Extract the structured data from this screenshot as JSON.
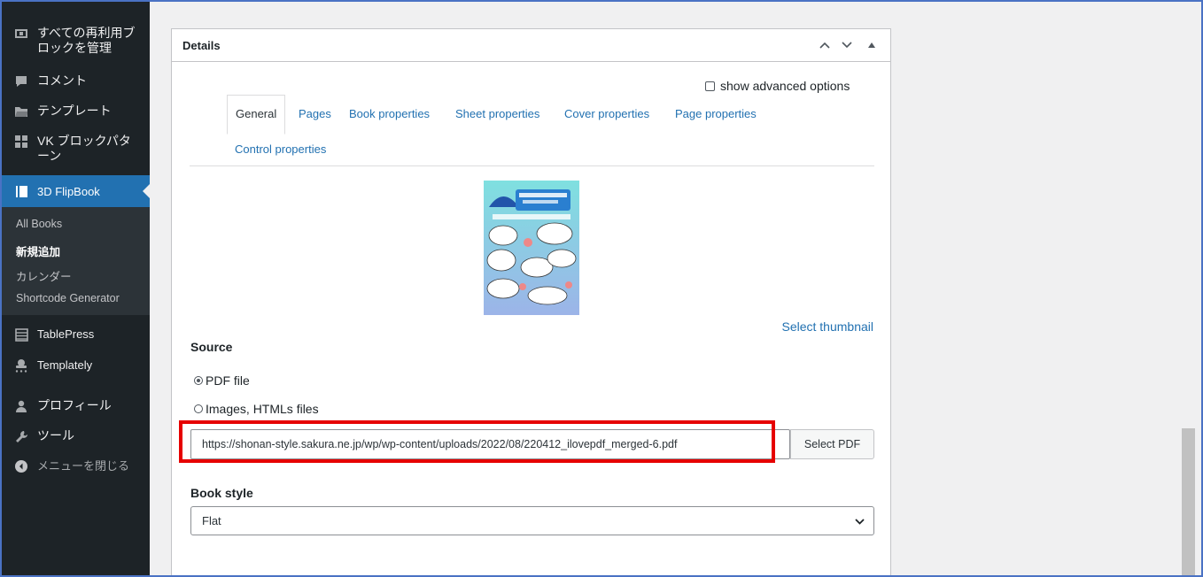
{
  "sidebar": {
    "items": [
      {
        "label": "すべての再利用ブロックを管理",
        "line1": "すべての再利用ブ",
        "line2": "ロックを管理",
        "icon": "reusable-block-icon"
      },
      {
        "label": "コメント",
        "icon": "comment-icon"
      },
      {
        "label": "テンプレート",
        "icon": "folder-icon"
      },
      {
        "label": "VK ブロックパターン",
        "line1": "VK ブロックパタ",
        "line2": "ーン",
        "icon": "grid-icon"
      },
      {
        "label": "3D FlipBook",
        "icon": "book-icon"
      },
      {
        "label": "TablePress",
        "icon": "table-icon"
      },
      {
        "label": "Templately",
        "icon": "templately-icon"
      },
      {
        "label": "プロフィール",
        "icon": "user-icon"
      },
      {
        "label": "ツール",
        "icon": "wrench-icon"
      },
      {
        "label": "メニューを閉じる",
        "icon": "collapse-icon"
      }
    ],
    "submenu": [
      "All Books",
      "新規追加",
      "カレンダー",
      "Shortcode Generator"
    ]
  },
  "panel": {
    "title": "Details",
    "advanced_label": "show advanced options",
    "tabs": [
      "General",
      "Pages",
      "Book properties",
      "Sheet properties",
      "Cover properties",
      "Page properties",
      "Control properties"
    ],
    "select_thumbnail": "Select thumbnail",
    "source_label": "Source",
    "source_options": [
      "PDF file",
      "Images, HTMLs files"
    ],
    "pdf_url": "https://shonan-style.sakura.ne.jp/wp/wp-content/uploads/2022/08/220412_ilovepdf_merged-6.pdf",
    "select_pdf": "Select PDF",
    "book_style_label": "Book style",
    "book_style_value": "Flat"
  },
  "colors": {
    "accent": "#2271b1",
    "sidebar_bg": "#1d2327",
    "highlight": "#e60000"
  }
}
